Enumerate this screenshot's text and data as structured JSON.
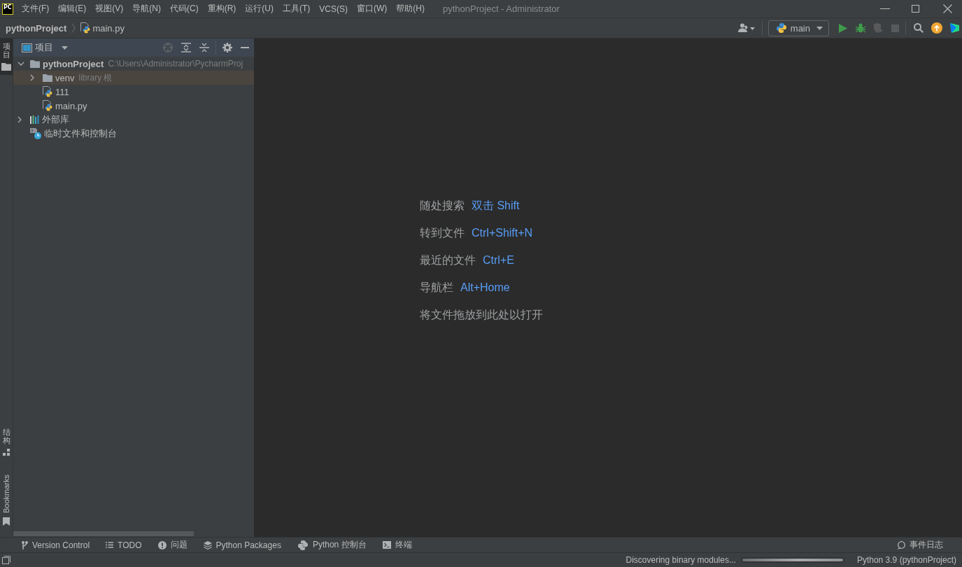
{
  "title_bar": {
    "logo": "PC",
    "menu": [
      "文件(F)",
      "编辑(E)",
      "视图(V)",
      "导航(N)",
      "代码(C)",
      "重构(R)",
      "运行(U)",
      "工具(T)",
      "VCS(S)",
      "窗口(W)",
      "帮助(H)"
    ],
    "title": "pythonProject - Administrator"
  },
  "nav_bar": {
    "breadcrumbs": [
      {
        "label": "pythonProject",
        "kind": "project"
      },
      {
        "label": "main.py",
        "kind": "python-file"
      }
    ],
    "run_config": "main",
    "toolbar": [
      {
        "kind": "run",
        "disabled": false
      },
      {
        "kind": "debug",
        "disabled": false
      },
      {
        "kind": "coverage",
        "disabled": true
      },
      {
        "kind": "stop",
        "disabled": true
      }
    ]
  },
  "left_stripe": {
    "top": [
      {
        "label": "项目",
        "kind": "project",
        "selected": true
      }
    ],
    "bottom": [
      {
        "label": "结构",
        "kind": "structure",
        "selected": false
      },
      {
        "label": "Bookmarks",
        "kind": "bookmarks",
        "selected": false
      }
    ]
  },
  "project_panel": {
    "title": "项目",
    "tools": [
      {
        "kind": "locate",
        "disabled": true
      },
      {
        "kind": "expand-all",
        "disabled": false
      },
      {
        "kind": "collapse-all",
        "disabled": false
      },
      {
        "kind": "settings",
        "disabled": false
      },
      {
        "kind": "hide",
        "disabled": false
      }
    ],
    "tree": [
      {
        "label": "pythonProject",
        "kind": "project",
        "hint": "C:\\Users\\Administrator\\PycharmProj",
        "expanded": true,
        "highlighted": false,
        "children": [
          {
            "label": "venv",
            "kind": "folder",
            "hint": "library 根",
            "expanded": false,
            "highlighted": true
          },
          {
            "label": "111",
            "kind": "python-file",
            "highlighted": false
          },
          {
            "label": "main.py",
            "kind": "python-file",
            "highlighted": false
          }
        ]
      },
      {
        "label": "外部库",
        "kind": "library",
        "expanded": false,
        "highlighted": false
      },
      {
        "label": "临时文件和控制台",
        "kind": "scratches",
        "highlighted": false
      }
    ]
  },
  "editor": {
    "hints": [
      {
        "label": "随处搜索",
        "shortcut": "双击 Shift"
      },
      {
        "label": "转到文件",
        "shortcut": "Ctrl+Shift+N"
      },
      {
        "label": "最近的文件",
        "shortcut": "Ctrl+E"
      },
      {
        "label": "导航栏",
        "shortcut": "Alt+Home"
      },
      {
        "label": "将文件拖放到此处以打开"
      }
    ]
  },
  "tool_window_bar": {
    "left": [
      {
        "label": "Version Control",
        "kind": "vcs",
        "selected": false
      },
      {
        "label": "TODO",
        "kind": "todo",
        "selected": false
      },
      {
        "label": "问题",
        "kind": "problems",
        "selected": false
      },
      {
        "label": "Python Packages",
        "kind": "packages",
        "selected": false
      },
      {
        "label": "Python 控制台",
        "kind": "console",
        "selected": false
      },
      {
        "label": "终端",
        "kind": "terminal",
        "selected": false
      }
    ],
    "right": [
      {
        "label": "事件日志",
        "kind": "event-log",
        "selected": false
      }
    ]
  },
  "status_bar": {
    "message": "Discovering binary modules...",
    "progress": {
      "level": 1
    },
    "interpreter": "Python 3.9 (pythonProject)"
  }
}
